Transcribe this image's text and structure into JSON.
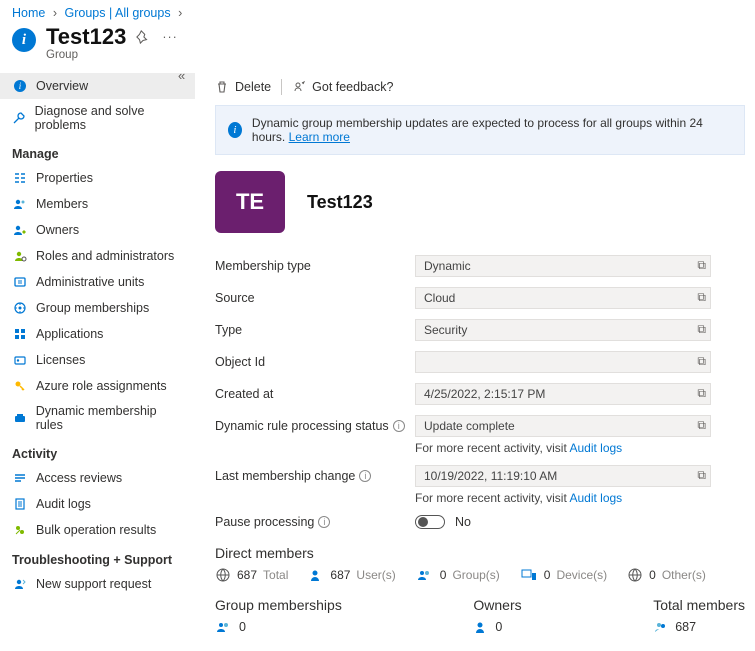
{
  "breadcrumb": {
    "home": "Home",
    "groups": "Groups | All groups"
  },
  "page": {
    "title": "Test123",
    "subtitle": "Group"
  },
  "toolbar": {
    "delete": "Delete",
    "feedback": "Got feedback?"
  },
  "banner": {
    "text": "Dynamic group membership updates are expected to process for all groups within 24 hours.",
    "learn": "Learn more"
  },
  "hero": {
    "initials": "TE",
    "name": "Test123"
  },
  "sidebar": {
    "overview": "Overview",
    "diagnose": "Diagnose and solve problems",
    "manage": "Manage",
    "properties": "Properties",
    "members": "Members",
    "owners": "Owners",
    "roles": "Roles and administrators",
    "adminunits": "Administrative units",
    "groupmem": "Group memberships",
    "apps": "Applications",
    "licenses": "Licenses",
    "azureroles": "Azure role assignments",
    "dynrules": "Dynamic membership rules",
    "activity": "Activity",
    "access": "Access reviews",
    "audit": "Audit logs",
    "bulk": "Bulk operation results",
    "trouble": "Troubleshooting + Support",
    "support": "New support request"
  },
  "props": {
    "membership_type_lbl": "Membership type",
    "membership_type": "Dynamic",
    "source_lbl": "Source",
    "source": "Cloud",
    "type_lbl": "Type",
    "type": "Security",
    "objectid_lbl": "Object Id",
    "objectid": "",
    "created_lbl": "Created at",
    "created": "4/25/2022, 2:15:17 PM",
    "dynstatus_lbl": "Dynamic rule processing status",
    "dynstatus": "Update complete",
    "lastchg_lbl": "Last membership change",
    "lastchg": "10/19/2022, 11:19:10 AM",
    "pause_lbl": "Pause processing",
    "pause_val": "No",
    "hint_pre": "For more recent activity, visit ",
    "hint_link": "Audit logs"
  },
  "direct": {
    "head": "Direct members",
    "total_n": "687",
    "total_t": "Total",
    "users_n": "687",
    "users_t": "User(s)",
    "groups_n": "0",
    "groups_t": "Group(s)",
    "devices_n": "0",
    "devices_t": "Device(s)",
    "others_n": "0",
    "others_t": "Other(s)"
  },
  "bottom": {
    "gm_head": "Group memberships",
    "gm_n": "0",
    "ow_head": "Owners",
    "ow_n": "0",
    "tm_head": "Total members",
    "tm_n": "687"
  }
}
